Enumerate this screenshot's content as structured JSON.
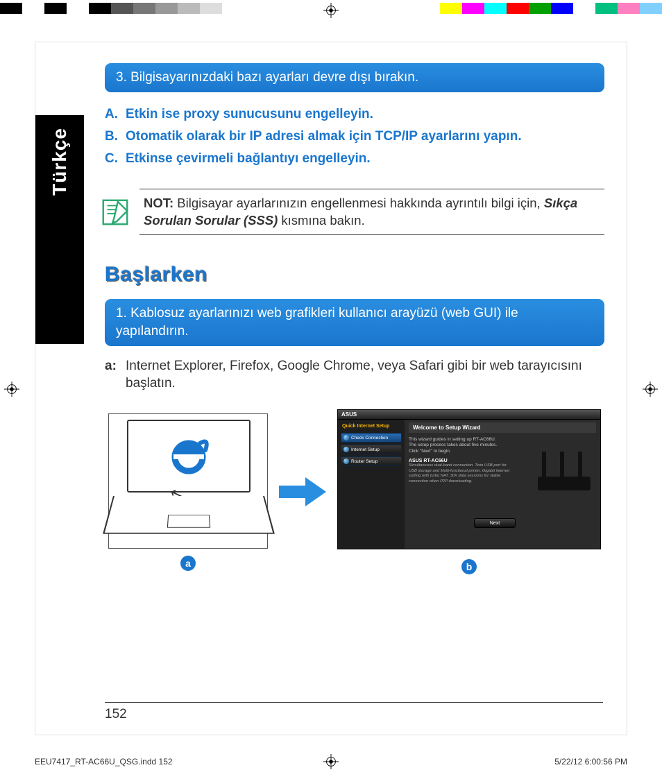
{
  "colorbar": {
    "left": [
      "#000000",
      "#ffffff",
      "#000000",
      "#ffffff",
      "#000000",
      "#555555",
      "#777777",
      "#999999",
      "#bbbbbb",
      "#dddddd"
    ],
    "right": [
      "#ffff00",
      "#ff00ff",
      "#00ffff",
      "#ff0000",
      "#00a000",
      "#0000ff",
      "#ffffff",
      "#00c080",
      "#ff80c0",
      "#80d0ff"
    ]
  },
  "lang": "Türkçe",
  "box3": "3.  Bilgisayarınızdaki bazı ayarları devre dışı bırakın.",
  "sub": {
    "A": "Etkin ise proxy sunucusunu engelleyin.",
    "B": "Otomatik olarak bir IP adresi almak için TCP/IP ayarlarını yapın.",
    "C": "Etkinse çevirmeli bağlantıyı engelleyin."
  },
  "note": {
    "label": "NOT:",
    "text1": " Bilgisayar ayarlarınızın engellenmesi hakkında ayrıntılı bilgi için, ",
    "faq": "Sıkça Sorulan Sorular (SSS)",
    "text2": " kısmına bakın."
  },
  "section": "Başlarken",
  "box1": "1.   Kablosuz ayarlarınızı web grafikleri kullanıcı arayüzü (web GUI) ile yapılandırın.",
  "step_a": {
    "label": "a:",
    "text": "Internet  Explorer, Firefox, Google Chrome, veya Safari gibi bir web tarayıcısını başlatın."
  },
  "badges": {
    "a": "a",
    "b": "b"
  },
  "router": {
    "brand": "ASUS",
    "side_hdr": "Quick Internet Setup",
    "btn1": "Check Connection",
    "btn2": "Internet Setup",
    "btn3": "Router Setup",
    "welcome": "Welcome to Setup Wizard",
    "desc1": "This wizard guides in setting up RT-AC66U.",
    "desc2": "The setup process takes about five minutes.",
    "desc3": "Click \"Next\" to begin.",
    "model": "ASUS RT-AC66U",
    "feat": "Simultaneous dual-band connection. Twin USB port for USB storage and Multi-functional printer. Gigabit internet surfing with turbo NAT. 30X data sessions for stable connection when P2P downloading.",
    "next": "Next"
  },
  "page_num": "152",
  "footer": {
    "file": "EEU7417_RT-AC66U_QSG.indd   152",
    "stamp": "5/22/12   6:00:56 PM"
  }
}
